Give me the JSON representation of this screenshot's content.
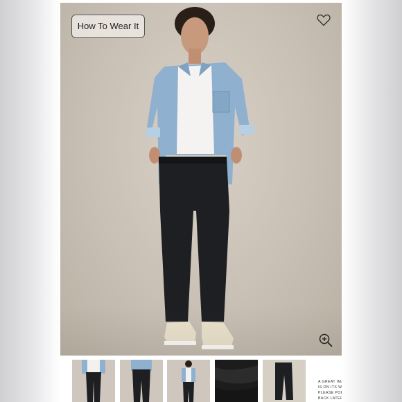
{
  "product_viewer": {
    "how_to_wear_label": "How To Wear It",
    "icons": {
      "favorite": "heart-icon",
      "zoom": "zoom-in-icon"
    },
    "thumbnails": [
      {
        "alt": "full-length front view"
      },
      {
        "alt": "full-length back view"
      },
      {
        "alt": "full-length styled view"
      },
      {
        "alt": "fabric close-up"
      },
      {
        "alt": "flat lay pants"
      }
    ],
    "notice_lines": [
      "A GREAT IMA",
      "IS ON ITS WA",
      "PLEASE POP",
      "BACK LATER"
    ]
  },
  "colors": {
    "backdrop": "#c9c0b5",
    "shirt": "#8fb1cf",
    "pants": "#1d1f22",
    "sneakers": "#e9e1cc"
  }
}
